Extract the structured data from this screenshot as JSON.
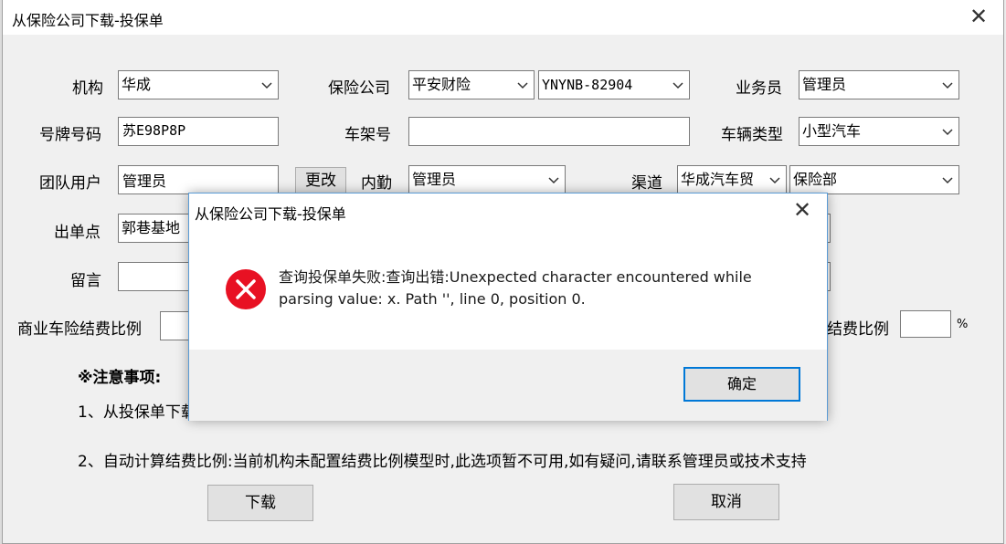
{
  "window": {
    "title": "从保险公司下载-投保单",
    "close_glyph": "✕"
  },
  "form": {
    "org_label": "机构",
    "org_value": "华成",
    "insurer_label": "保险公司",
    "insurer_value": "平安财险",
    "insurer_code": "YNYNB-82904",
    "salesman_label": "业务员",
    "salesman_value": "管理员",
    "plate_label": "号牌号码",
    "plate_value": "苏E98P8P",
    "vin_label": "车架号",
    "vin_value": "",
    "vehicle_type_label": "车辆类型",
    "vehicle_type_value": "小型汽车",
    "team_user_label": "团队用户",
    "team_user_value": "管理员",
    "change_button": "更改",
    "internal_label": "内勤",
    "internal_value": "管理员",
    "channel_label": "渠道",
    "channel_value": "华成汽车贸",
    "department_value": "保险部",
    "outlet_label": "出单点",
    "outlet_value": "郭巷基地",
    "message_label": "留言",
    "message_value": "",
    "commercial_ratio_label": "商业车险结费比例",
    "commercial_ratio_value": "",
    "other_ratio_label": "结费比例",
    "other_ratio_value": "",
    "percent_sign": "%"
  },
  "notes": {
    "title": "※注意事项:",
    "line1": "1、从投保单下载",
    "line2": "2、自动计算结费比例:当前机构未配置结费比例模型时,此选项暂不可用,如有疑问,请联系管理员或技术支持"
  },
  "buttons": {
    "download": "下载",
    "cancel": "取消"
  },
  "dialog": {
    "title": "从保险公司下载-投保单",
    "message": "查询投保单失败:查询出错:Unexpected character encountered while parsing value: x. Path '', line 0, position 0.",
    "ok": "确定",
    "close_glyph": "✕",
    "icon": "error-icon"
  },
  "colors": {
    "error_red": "#e81123",
    "accent_blue": "#0078d7",
    "window_bg": "#f0f0f0"
  }
}
